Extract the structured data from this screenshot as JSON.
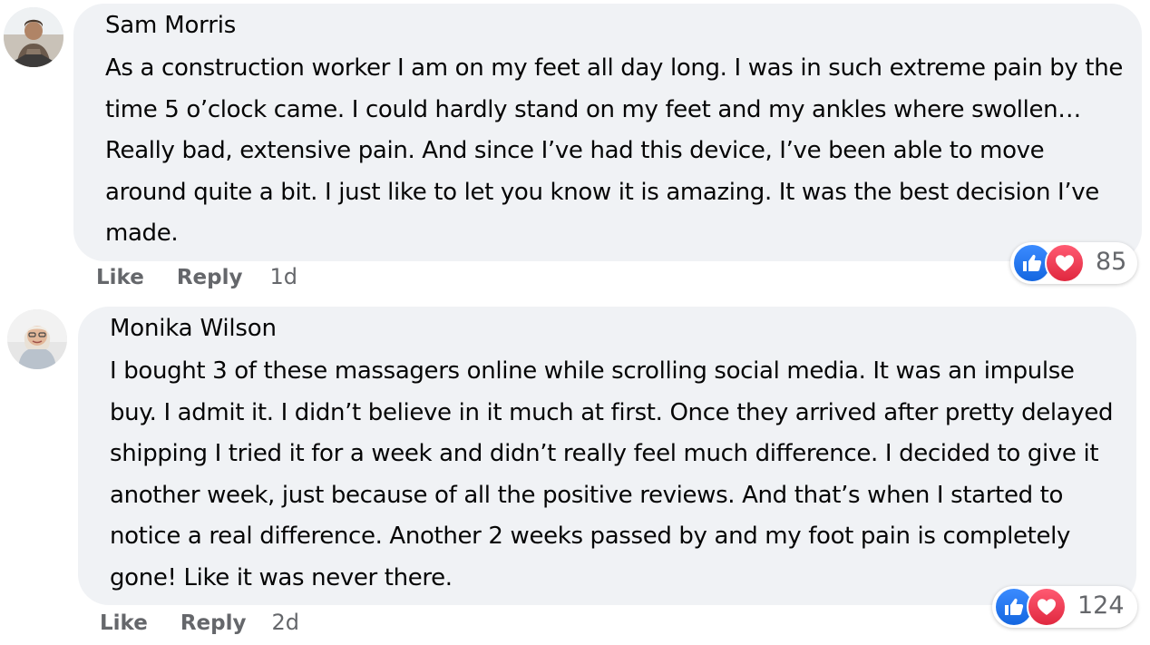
{
  "comments": [
    {
      "author": "Sam Morris",
      "text": "As a construction worker I am on my feet all day long. I was in such extreme pain by the time 5 o’clock came. I could hardly stand on my feet and my ankles where swollen… Really bad, extensive pain. And since I’ve had this device, I’ve been able to move around quite a bit. I just like to let you know it is amazing. It was the best decision I’ve made.",
      "like_label": "Like",
      "reply_label": "Reply",
      "time": "1d",
      "reaction_count": "85",
      "reaction_icons": [
        "like-icon",
        "love-icon"
      ]
    },
    {
      "author": "Monika Wilson",
      "text": "I bought 3 of these massagers online while scrolling social media. It was an impulse buy. I admit it. I didn’t believe in it much at first. Once they arrived after pretty delayed shipping I tried it for a week and didn’t really feel much difference. I decided to give it another week, just because of all the positive reviews. And that’s when I started to notice a real difference. Another 2 weeks passed by and my foot pain is completely gone! Like it was never there.",
      "like_label": "Like",
      "reply_label": "Reply",
      "time": "2d",
      "reaction_count": "124",
      "reaction_icons": [
        "like-icon",
        "love-icon"
      ]
    }
  ],
  "colors": {
    "bubble": "#f0f2f5",
    "secondary_text": "#65676b",
    "like_blue": "#1877f2",
    "love_red": "#f33e58"
  }
}
